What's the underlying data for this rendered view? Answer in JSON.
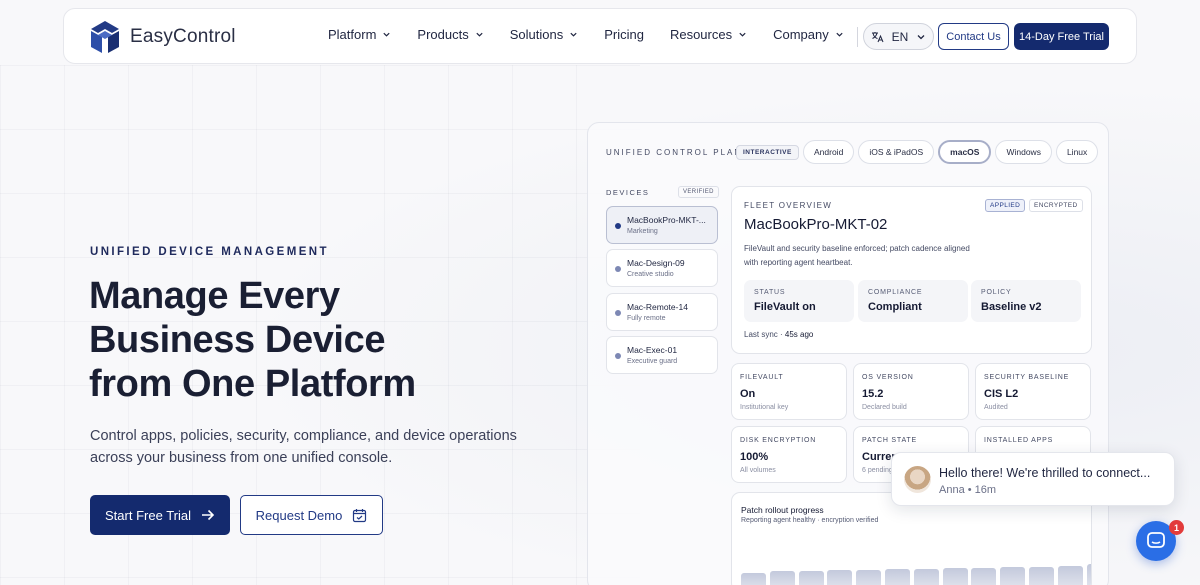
{
  "nav": {
    "brand": "EasyControl",
    "items": [
      {
        "label": "Platform",
        "has_dropdown": true
      },
      {
        "label": "Products",
        "has_dropdown": true
      },
      {
        "label": "Solutions",
        "has_dropdown": true
      },
      {
        "label": "Pricing",
        "has_dropdown": false
      },
      {
        "label": "Resources",
        "has_dropdown": true
      },
      {
        "label": "Company",
        "has_dropdown": true
      }
    ],
    "language": "EN",
    "contact_label": "Contact Us",
    "trial_label": "14-Day Free Trial"
  },
  "hero": {
    "eyebrow": "UNIFIED DEVICE MANAGEMENT",
    "headline_lines": [
      "Manage Every",
      "Business Device",
      "from One Platform"
    ],
    "subtext": "Control apps, policies, security, compliance, and device operations across your business from one unified console.",
    "primary_cta": "Start Free Trial",
    "secondary_cta": "Request Demo"
  },
  "console": {
    "label": "UNIFIED CONTROL PLANE",
    "interactive_badge": "INTERACTIVE",
    "os_tabs": [
      "Android",
      "iOS & iPadOS",
      "macOS",
      "Windows",
      "Linux"
    ],
    "active_os": "macOS",
    "devices_label": "DEVICES",
    "verified_badge": "VERIFIED",
    "devices": [
      {
        "name": "MacBookPro-MKT-...",
        "sub": "Marketing",
        "active": true
      },
      {
        "name": "Mac-Design-09",
        "sub": "Creative studio",
        "active": false
      },
      {
        "name": "Mac-Remote-14",
        "sub": "Fully remote",
        "active": false
      },
      {
        "name": "Mac-Exec-01",
        "sub": "Executive guard",
        "active": false
      }
    ],
    "fleet": {
      "label": "FLEET OVERVIEW",
      "badge_applied": "APPLIED",
      "badge_encrypted": "ENCRYPTED",
      "title": "MacBookPro-MKT-02",
      "description": "FileVault and security baseline enforced; patch cadence aligned with reporting agent heartbeat.",
      "stats": [
        {
          "label": "STATUS",
          "value": "FileVault on"
        },
        {
          "label": "COMPLIANCE",
          "value": "Compliant"
        },
        {
          "label": "POLICY",
          "value": "Baseline v2"
        }
      ],
      "last_sync_label": "Last sync · ",
      "last_sync_value": "45s ago"
    },
    "tiles": [
      {
        "label": "FILEVAULT",
        "value": "On",
        "sub": "Institutional key"
      },
      {
        "label": "OS VERSION",
        "value": "15.2",
        "sub": "Declared build"
      },
      {
        "label": "SECURITY BASELINE",
        "value": "CIS L2",
        "sub": "Audited"
      },
      {
        "label": "DISK ENCRYPTION",
        "value": "100%",
        "sub": "All volumes"
      },
      {
        "label": "PATCH STATE",
        "value": "Current",
        "sub": "6 pending"
      },
      {
        "label": "INSTALLED APPS",
        "value": "",
        "sub": ""
      }
    ],
    "rollout": {
      "title": "Patch rollout progress",
      "subtitle": "Reporting agent healthy · encryption verified",
      "bar_levels": [
        0.42,
        0.45,
        0.45,
        0.47,
        0.47,
        0.5,
        0.5,
        0.52,
        0.52,
        0.55,
        0.55,
        0.57,
        0.6
      ]
    }
  },
  "chat": {
    "message": "Hello there! We're thrilled to connect...",
    "sender": "Anna",
    "time": "16m",
    "unread": "1"
  },
  "colors": {
    "brand_navy": "#142a6e",
    "accent_blue": "#2a6ee6",
    "badge_red": "#e23b3b"
  }
}
